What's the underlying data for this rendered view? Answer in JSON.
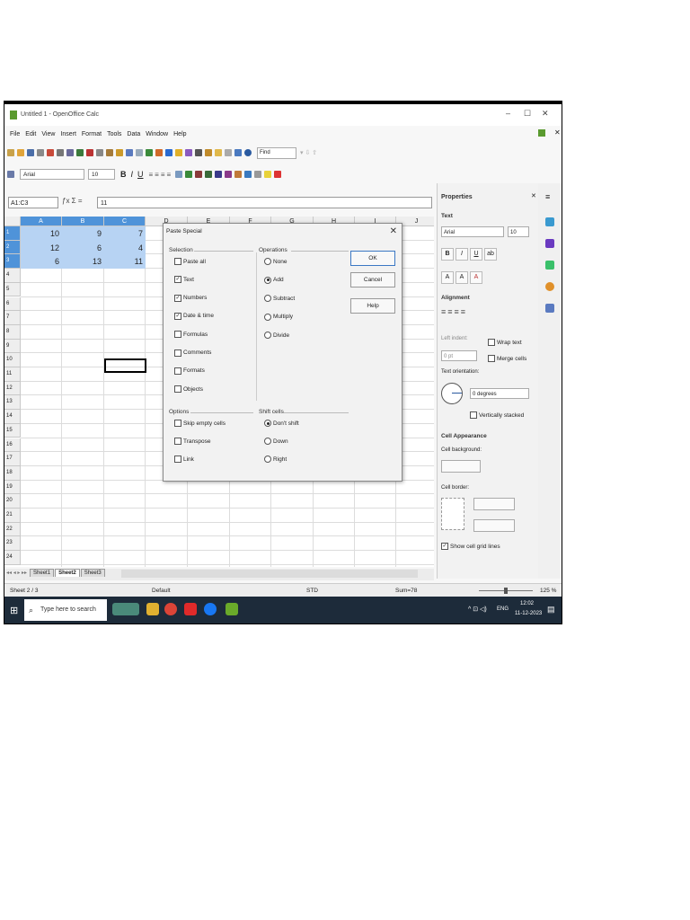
{
  "window": {
    "title": "Untitled 1 - OpenOffice Calc",
    "controls": [
      "–",
      "☐",
      "✕"
    ]
  },
  "menu": [
    "File",
    "Edit",
    "View",
    "Insert",
    "Format",
    "Tools",
    "Data",
    "Window",
    "Help"
  ],
  "toolbar": {
    "find_placeholder": "Find",
    "font_name": "Arial",
    "font_size": "10",
    "bold": "B",
    "italic": "I",
    "underline": "U"
  },
  "formula_bar": {
    "name_box": "A1:C3",
    "fx": "ƒx Σ =",
    "content": "11"
  },
  "grid": {
    "columns": [
      "A",
      "B",
      "C",
      "D",
      "E",
      "F",
      "G",
      "H",
      "I",
      "J"
    ],
    "rows": [
      "1",
      "2",
      "3",
      "4",
      "5",
      "6",
      "7",
      "8",
      "9",
      "10",
      "11",
      "12",
      "13",
      "14",
      "15",
      "16",
      "17",
      "18",
      "19",
      "20",
      "21",
      "22",
      "23",
      "24"
    ],
    "cells": [
      [
        "10",
        "9",
        "7"
      ],
      [
        "12",
        "6",
        "4"
      ],
      [
        "6",
        "13",
        "11"
      ]
    ]
  },
  "sheet_tabs": [
    "Sheet1",
    "Sheet2",
    "Sheet3"
  ],
  "status": {
    "sheet": "Sheet 2 / 3",
    "style": "Default",
    "mode": "STD",
    "sum": "Sum=78",
    "zoom": "125 %"
  },
  "sidebar": {
    "title": "Properties",
    "text_section": "Text",
    "font": "Arial",
    "size": "10",
    "alignment_section": "Alignment",
    "left_indent_label": "Left indent:",
    "indent_value": "0 pt",
    "wrap_text": "Wrap text",
    "merge_cells": "Merge cells",
    "orientation_label": "Text orientation:",
    "degrees": "0 degrees",
    "vertically_stacked": "Vertically stacked",
    "cell_appearance_section": "Cell Appearance",
    "cell_background_label": "Cell background:",
    "cell_border_label": "Cell border:",
    "show_grid_lines": "Show cell grid lines"
  },
  "dialog": {
    "title": "Paste Special",
    "selection_label": "Selection",
    "selection": [
      {
        "label": "Paste all",
        "checked": false
      },
      {
        "label": "Text",
        "checked": true
      },
      {
        "label": "Numbers",
        "checked": true
      },
      {
        "label": "Date & time",
        "checked": true
      },
      {
        "label": "Formulas",
        "checked": false
      },
      {
        "label": "Comments",
        "checked": false
      },
      {
        "label": "Formats",
        "checked": false
      },
      {
        "label": "Objects",
        "checked": false
      }
    ],
    "operations_label": "Operations",
    "operations": [
      {
        "label": "None",
        "selected": false
      },
      {
        "label": "Add",
        "selected": true
      },
      {
        "label": "Subtract",
        "selected": false
      },
      {
        "label": "Multiply",
        "selected": false
      },
      {
        "label": "Divide",
        "selected": false
      }
    ],
    "options_label": "Options",
    "options": [
      {
        "label": "Skip empty cells",
        "checked": false
      },
      {
        "label": "Transpose",
        "checked": false
      },
      {
        "label": "Link",
        "checked": false
      }
    ],
    "shift_label": "Shift cells",
    "shift": [
      {
        "label": "Don't shift",
        "selected": true
      },
      {
        "label": "Down",
        "selected": false
      },
      {
        "label": "Right",
        "selected": false
      }
    ],
    "buttons": {
      "ok": "OK",
      "cancel": "Cancel",
      "help": "Help"
    }
  },
  "taskbar": {
    "search_placeholder": "Type here to search",
    "time": "12:02",
    "date": "11-12-2023",
    "lang": "ENG"
  }
}
